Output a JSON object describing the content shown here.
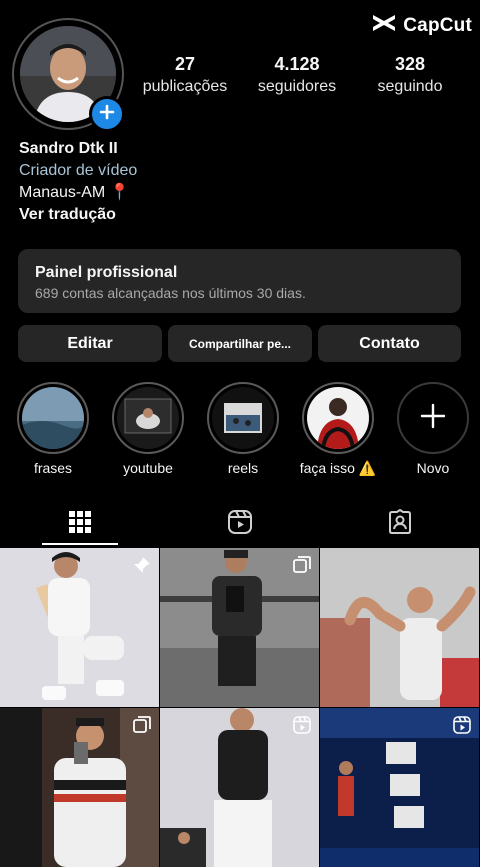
{
  "watermark": {
    "brand": "CapCut"
  },
  "profile": {
    "name": "Sandro Dtk II",
    "category": "Criador de vídeo",
    "location": "Manaus-AM 📍",
    "translate": "Ver tradução",
    "avatar_icon": "avatar-photo",
    "add_icon": "plus-icon"
  },
  "stats": [
    {
      "value": "27",
      "label": "publicações"
    },
    {
      "value": "4.128",
      "label": "seguidores"
    },
    {
      "value": "328",
      "label": "seguindo"
    }
  ],
  "panel": {
    "title": "Painel profissional",
    "subtitle": "689 contas alcançadas nos últimos 30 dias."
  },
  "buttons": {
    "edit": "Editar",
    "share": "Compartilhar pe...",
    "contact": "Contato"
  },
  "highlights": [
    {
      "label": "frases"
    },
    {
      "label": "youtube"
    },
    {
      "label": "reels"
    },
    {
      "label": "faça isso ⚠️"
    },
    {
      "label": "Novo"
    }
  ],
  "tabs": [
    "grid-icon",
    "reels-icon",
    "tagged-icon"
  ],
  "colors": {
    "background": "#000000",
    "surface": "#262626",
    "accent_blue": "#1e88e5",
    "category_text": "#a9c4d6"
  }
}
